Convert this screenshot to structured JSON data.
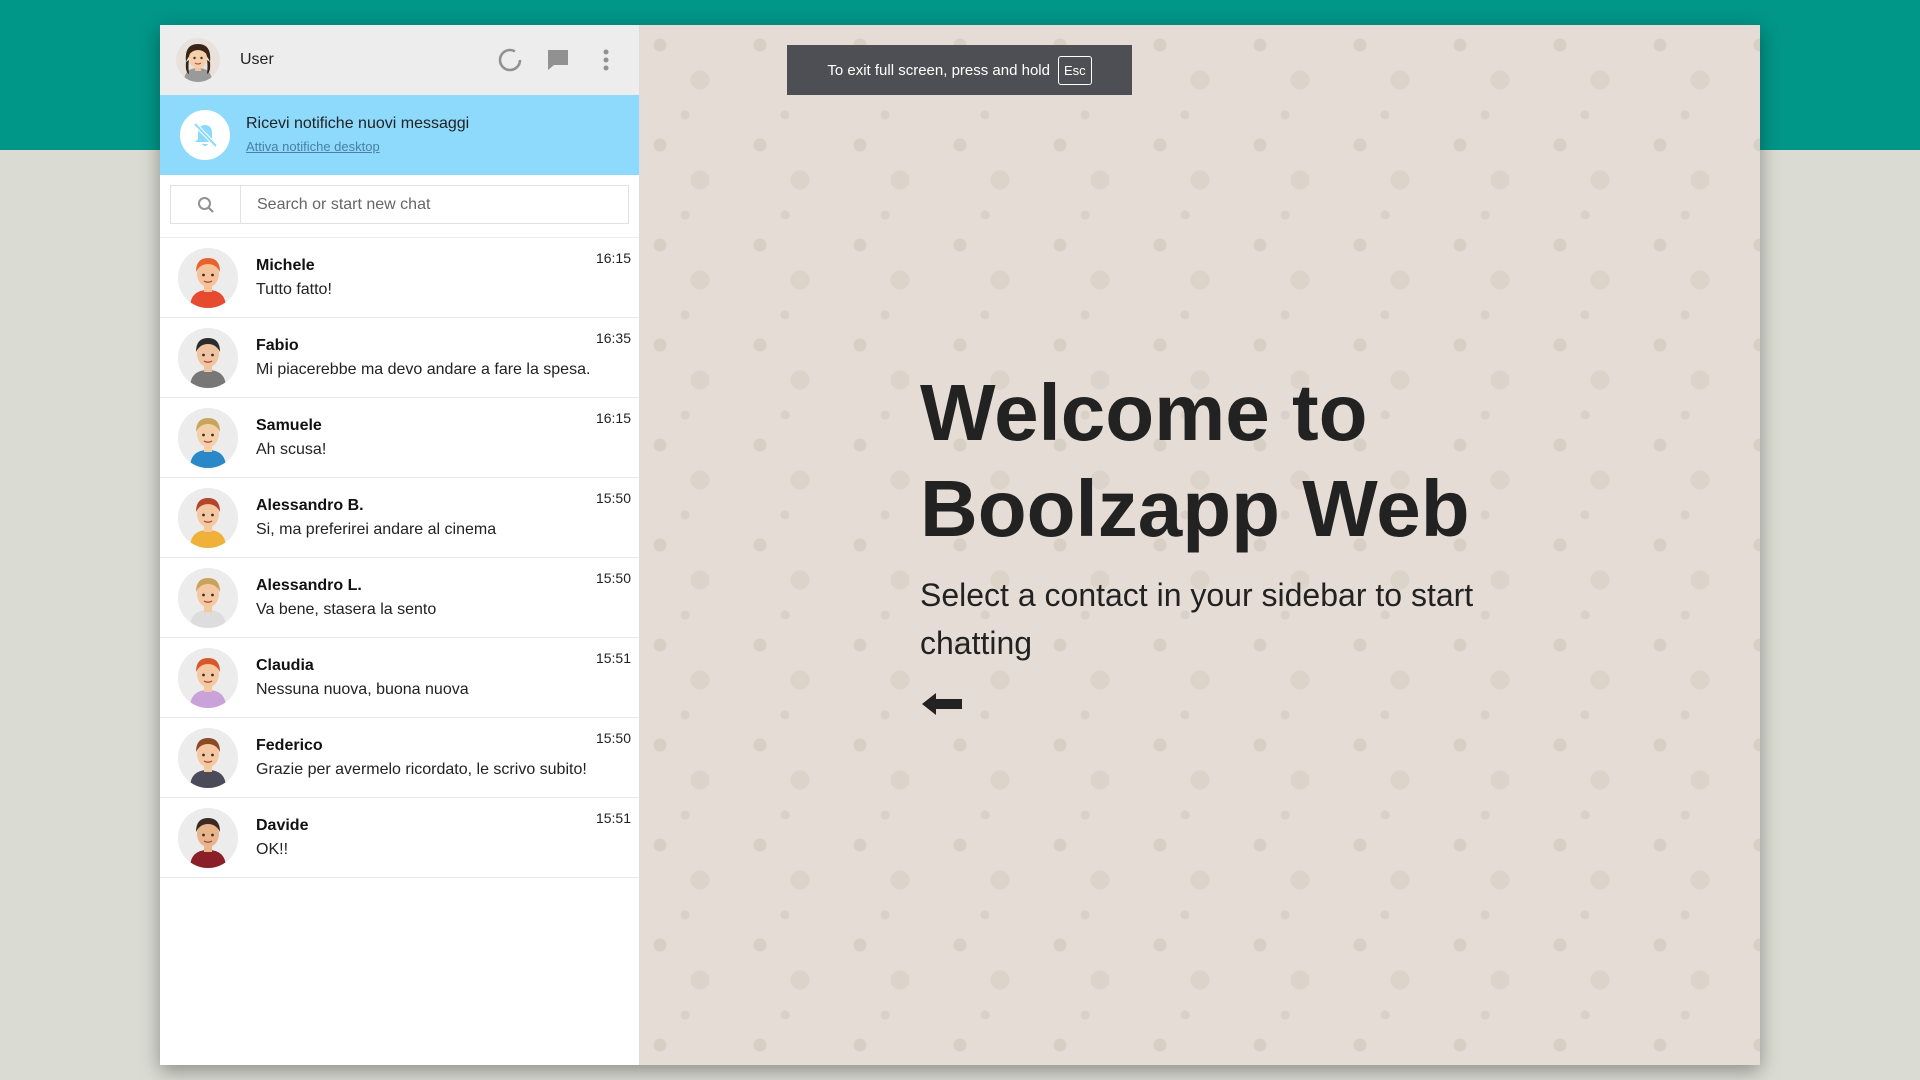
{
  "header": {
    "user_name": "User"
  },
  "notification": {
    "title": "Ricevi notifiche nuovi messaggi",
    "link": "Attiva notifiche desktop"
  },
  "search": {
    "placeholder": "Search or start new chat"
  },
  "contacts": [
    {
      "name": "Michele",
      "last_message": "Tutto fatto!",
      "time": "16:15",
      "hair": "#e8632b",
      "shirt": "#e64a2f",
      "skin": "#f5c29a"
    },
    {
      "name": "Fabio",
      "last_message": "Mi piacerebbe ma devo andare a fare la spesa.",
      "time": "16:35",
      "hair": "#2b2b2b",
      "shirt": "#777777",
      "skin": "#f0c4a0"
    },
    {
      "name": "Samuele",
      "last_message": "Ah scusa!",
      "time": "16:15",
      "hair": "#c9a45a",
      "shirt": "#2a88c8",
      "skin": "#f5cfa8"
    },
    {
      "name": "Alessandro B.",
      "last_message": "Si, ma preferirei andare al cinema",
      "time": "15:50",
      "hair": "#b5452a",
      "shirt": "#f0b13a",
      "skin": "#f5c8a2"
    },
    {
      "name": "Alessandro L.",
      "last_message": "Va bene, stasera la sento",
      "time": "15:50",
      "hair": "#c9a35a",
      "shirt": "#dddddd",
      "skin": "#f5c8a2"
    },
    {
      "name": "Claudia",
      "last_message": "Nessuna nuova, buona nuova",
      "time": "15:51",
      "hair": "#d8572a",
      "shirt": "#c8a2d8",
      "skin": "#f5c8a2"
    },
    {
      "name": "Federico",
      "last_message": "Grazie per avermelo ricordato, le scrivo subito!",
      "time": "15:50",
      "hair": "#8a4a28",
      "shirt": "#4a4a58",
      "skin": "#f5c8a2"
    },
    {
      "name": "Davide",
      "last_message": "OK!!",
      "time": "15:51",
      "hair": "#3a2a22",
      "shirt": "#8a1f28",
      "skin": "#e8b48a"
    }
  ],
  "toast": {
    "text": "To exit full screen, press and hold",
    "key": "Esc"
  },
  "welcome": {
    "title": "Welcome to Boolzapp Web",
    "subtitle": "Select a contact in your sidebar to start chatting"
  },
  "icons": {
    "status": "status-icon",
    "chat": "chat-icon",
    "menu": "menu-icon",
    "bell": "bell-off-icon",
    "search": "search-icon",
    "arrow": "arrow-left-icon"
  },
  "colors": {
    "brand": "#009688",
    "notification": "#8edafc",
    "chat_background": "#e5ddd5"
  }
}
